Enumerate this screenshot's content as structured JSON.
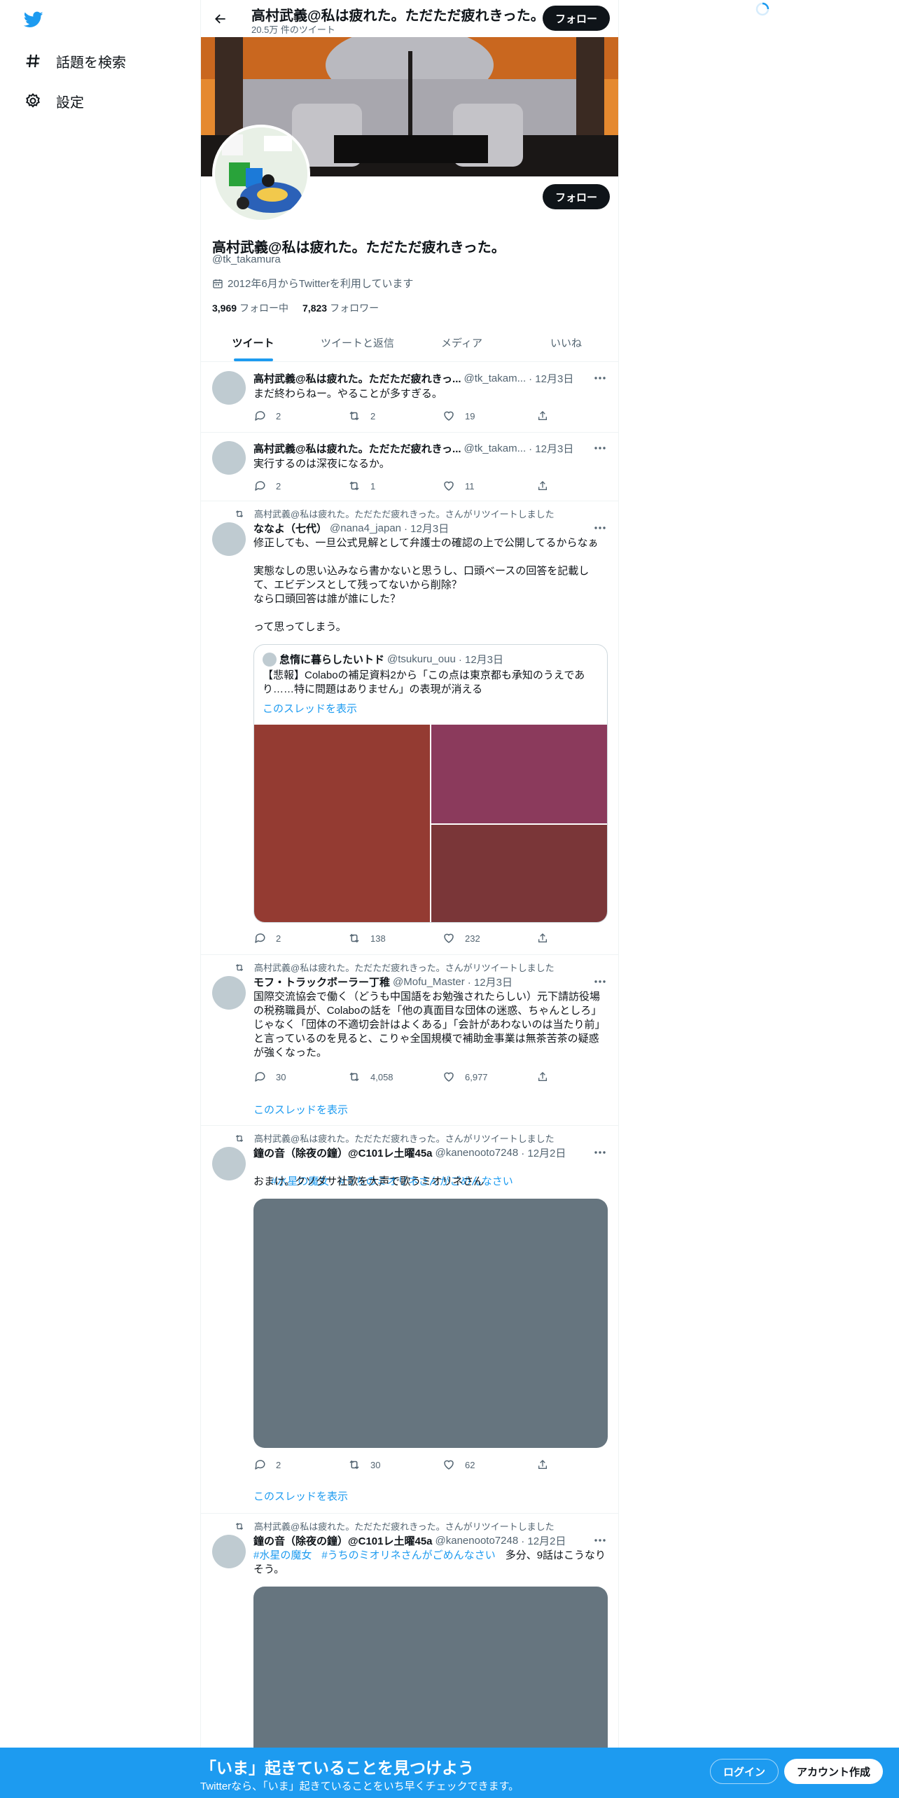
{
  "nav": {
    "explore_label": "話題を検索",
    "settings_label": "設定"
  },
  "header": {
    "name": "高村武義@私は疲れた。ただただ疲れきった。",
    "tweet_count": "20.5万 件のツイート",
    "follow_label": "フォロー"
  },
  "profile": {
    "name": "高村武義@私は疲れた。ただただ疲れきった。",
    "handle": "@tk_takamura",
    "joined": "2012年6月からTwitterを利用しています",
    "following_count": "3,969",
    "following_label": "フォロー中",
    "followers_count": "7,823",
    "followers_label": "フォロワー",
    "follow_label": "フォロー"
  },
  "tabs": [
    "ツイート",
    "ツイートと返信",
    "メディア",
    "いいね"
  ],
  "tweets": [
    {
      "name": "高村武義@私は疲れた。ただただ疲れきっ...",
      "handle": "@tk_takam...",
      "date": "· 12月3日",
      "text": "まだ終わらねー。やることが多すぎる。",
      "replies": "2",
      "retweets": "2",
      "likes": "19"
    },
    {
      "name": "高村武義@私は疲れた。ただただ疲れきっ...",
      "handle": "@tk_takam...",
      "date": "· 12月3日",
      "text": "実行するのは深夜になるか。",
      "replies": "2",
      "retweets": "1",
      "likes": "11"
    },
    {
      "retweeted_by": "高村武義@私は疲れた。ただただ疲れきった。さんがリツイートしました",
      "name": "ななよ（七代）",
      "handle": "@nana4_japan",
      "date": "· 12月3日",
      "text": "修正しても、一旦公式見解として弁護士の確認の上で公開してるからなぁ\n\n実態なしの思い込みなら書かないと思うし、口頭ベースの回答を記載して、エビデンスとして残ってないから削除？\nなら口頭回答は誰が誰にした？\n\nって思ってしまう。",
      "quote": {
        "name": "怠惰に暮らしたいトド",
        "handle": "@tsukuru_ouu",
        "date": "· 12月3日",
        "text": "【悲報】Colaboの補足資料2から「この点は東京都も承知のうえであり……特に問題はありません」の表現が消える",
        "thread_link": "このスレッドを表示"
      },
      "replies": "2",
      "retweets": "138",
      "likes": "232"
    },
    {
      "retweeted_by": "高村武義@私は疲れた。ただただ疲れきった。さんがリツイートしました",
      "name": "モフ・トラックボーラー丁稚",
      "handle": "@Mofu_Master",
      "date": "· 12月3日",
      "text": "国際交流協会で働く（どうも中国語をお勉強されたらしい）元下請訪役場の税務職員が、Colaboの話を「他の真面目な団体の迷惑、ちゃんとしろ」じゃなく「団体の不適切会計はよくある」「会計があわないのは当たり前」と言っているのを見ると、こりゃ全国規模で補助金事業は無茶苦茶の疑惑が強くなった。",
      "replies": "30",
      "retweets": "4,058",
      "likes": "6,977",
      "thread_link": "このスレッドを表示"
    },
    {
      "retweeted_by": "高村武義@私は疲れた。ただただ疲れきった。さんがリツイートしました",
      "name": "鐘の音（除夜の鐘）@C101レ土曜45a",
      "handle": "@kanenooto7248",
      "date": "· 12月2日",
      "tags": [
        "#水星の魔女",
        "#うちのミオリネさんがごめんなさい"
      ],
      "text": "おまけ。クソダサ社歌を大声で歌うミオリネさん",
      "replies": "2",
      "retweets": "30",
      "likes": "62",
      "thread_link": "このスレッドを表示"
    },
    {
      "retweeted_by": "高村武義@私は疲れた。ただただ疲れきった。さんがリツイートしました",
      "name": "鐘の音（除夜の鐘）@C101レ土曜45a",
      "handle": "@kanenooto7248",
      "date": "· 12月2日",
      "tags": [
        "#水星の魔女",
        "#うちのミオリネさんがごめんなさい"
      ],
      "text": "多分、9話はこうなりそう。"
    }
  ],
  "bottom_bar": {
    "title": "「いま」起きていることを見つけよう",
    "subtitle": "Twitterなら、「いま」起きていることをいち早くチェックできます。",
    "login_label": "ログイン",
    "signup_label": "アカウント作成"
  },
  "colors": {
    "brand": "#1d9bf0",
    "text": "#0f1419",
    "secondary": "#536471",
    "quote_media_left": "#943b32",
    "quote_media_top_right": "#8b3a5c",
    "quote_media_bottom_right": "#7a3638",
    "media_placeholder": "#66757f"
  }
}
